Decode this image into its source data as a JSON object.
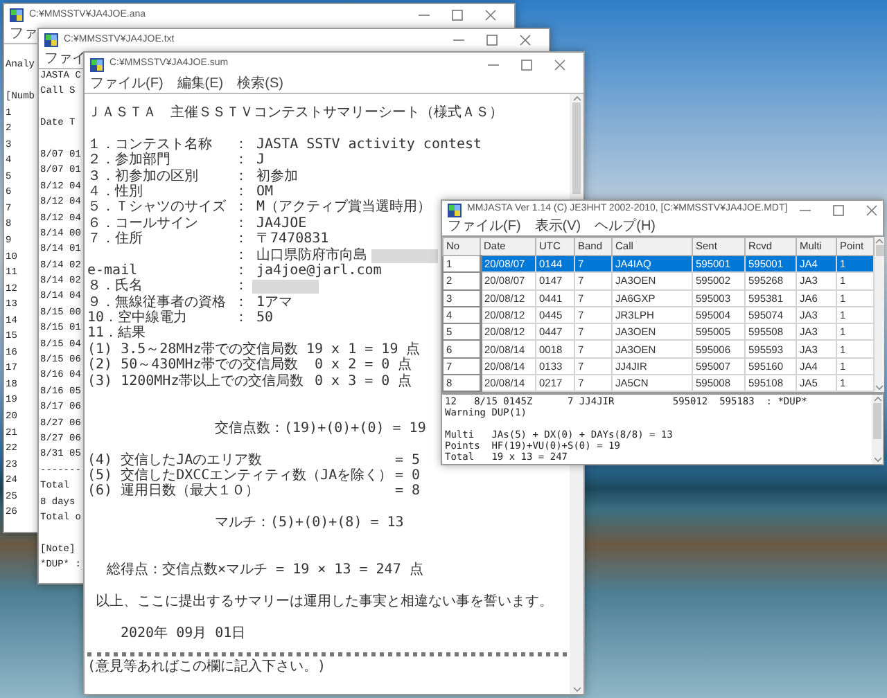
{
  "analysis_window": {
    "title": "C:¥MMSSTV¥JA4JOE.ana",
    "menu": [
      "ファ"
    ],
    "paragraphs": [
      [
        "Analy"
      ],
      [
        "[Numb",
        "1",
        "2",
        "3",
        "4",
        "5",
        "6",
        "7",
        "8",
        "9",
        "10",
        "11",
        "12",
        "13",
        "14",
        "15",
        "16",
        "17",
        "18",
        "19",
        "20",
        "21",
        "22",
        "23",
        "24",
        "25",
        "26"
      ]
    ]
  },
  "log_text_window": {
    "title": "C:¥MMSSTV¥JA4JOE.txt",
    "menu": [
      "ファイ"
    ],
    "paragraphs": [
      [
        "JASTA C",
        "Call S"
      ],
      [
        "Date T"
      ],
      [
        "8/07 01",
        "8/07 01",
        "8/12 04",
        "8/12 04",
        "8/12 04",
        "8/14 00",
        "8/14 01",
        "8/14 02",
        "8/14 02",
        "8/14 04",
        "8/15 00",
        "8/15 01",
        "8/15 04",
        "8/15 06",
        "8/16 04",
        "8/16 05",
        "8/17 06",
        "8/27 06",
        "8/27 06",
        "8/31 05",
        "-------",
        "Total",
        "8 days",
        "Total o"
      ],
      [
        "[Note]",
        "*DUP* :"
      ]
    ]
  },
  "summary_window": {
    "title": "C:¥MMSSTV¥JA4JOE.sum",
    "menu": [
      "ファイル(F)",
      "編集(E)",
      "検索(S)"
    ],
    "blocks": [
      {
        "kind": "title",
        "text": "ＪＡＳＴＡ　主催ＳＳＴＶコンテストサマリーシート（様式ＡＳ）"
      },
      {
        "kind": "fields",
        "rows": [
          {
            "label": "１．コンテスト名称",
            "value": "： JASTA SSTV activity contest",
            "redacted": false
          },
          {
            "label": "２．参加部門",
            "value": "： J",
            "redacted": false
          },
          {
            "label": "３．初参加の区別",
            "value": "： 初参加",
            "redacted": false
          },
          {
            "label": "４．性別",
            "value": "： OM",
            "redacted": false
          },
          {
            "label": "５．Ｔシャツのサイズ",
            "value": "： M（アクティブ賞当選時用）",
            "redacted": false
          },
          {
            "label": "６．コールサイン",
            "value": "： JA4JOE",
            "redacted": false
          },
          {
            "label": "７．住所",
            "value": "： 〒7470831",
            "redacted": false
          },
          {
            "value": "： 山口県防府市向島",
            "redacted": true
          },
          {
            "label": "e-mail",
            "value": "： ja4joe@jarl.com",
            "redacted": false
          },
          {
            "label": "８．氏名",
            "value": "：",
            "redacted": true
          },
          {
            "label": "９．無線従事者の資格",
            "value": "： 1アマ",
            "redacted": false
          },
          {
            "label": "10．空中線電力",
            "value": "： 50",
            "redacted": false
          },
          {
            "label": "11．結果",
            "redacted": false
          }
        ]
      },
      {
        "kind": "counts",
        "rows": [
          {
            "label": "(1) 3.5～28MHz帯での交信局数",
            "value": "19 x 1 = 19 点"
          },
          {
            "label": "(2) 50～430MHz帯での交信局数",
            "value": " 0 x 2 = 0 点"
          },
          {
            "label": "(3) 1200MHz帯以上での交信局数",
            "value": " 0 x 3 = 0 点"
          }
        ]
      },
      {
        "kind": "points",
        "text": "交信点数：(19)+(0)+(0) = 19"
      },
      {
        "kind": "areas",
        "rows": [
          {
            "label": "(4) 交信したJAのエリア数",
            "value": "= 5"
          },
          {
            "label": "(5) 交信したDXCCエンティティ数（JAを除く）",
            "value": "= 0"
          },
          {
            "label": "(6) 運用日数（最大１０）",
            "value": "= 8"
          }
        ]
      },
      {
        "kind": "multiplier",
        "text": "マルチ：(5)+(0)+(8) = 13"
      },
      {
        "kind": "total",
        "text": "総得点：交信点数×マルチ = 19 × 13 = 247 点"
      },
      {
        "kind": "statement",
        "text": "以上、ここに提出するサマリーは運用した事実と相違ない事を誓います。"
      },
      {
        "kind": "date",
        "text": "2020年 09月 01日"
      },
      {
        "kind": "separator"
      },
      {
        "kind": "note",
        "text": "(意見等あればこの欄に記入下さい。)"
      }
    ]
  },
  "mmjasta_window": {
    "title": "MMJASTA Ver 1.14 (C) JE3HHT 2002-2010, [C:¥MMSSTV¥JA4JOE.MDT]",
    "menu": [
      "ファイル(F)",
      "表示(V)",
      "ヘルプ(H)"
    ],
    "table": {
      "columns": [
        "No",
        "Date",
        "UTC",
        "Band",
        "Call",
        "Sent",
        "Rcvd",
        "Multi",
        "Point"
      ],
      "rows": [
        {
          "cells": [
            "1",
            "20/08/07",
            "0144",
            "7",
            "JA4IAQ",
            "595001",
            "595001",
            "JA4",
            "1"
          ],
          "selected": true
        },
        {
          "cells": [
            "2",
            "20/08/07",
            "0147",
            "7",
            "JA3OEN",
            "595002",
            "595268",
            "JA3",
            "1"
          ],
          "selected": false
        },
        {
          "cells": [
            "3",
            "20/08/12",
            "0441",
            "7",
            "JA6GXP",
            "595003",
            "595381",
            "JA6",
            "1"
          ],
          "selected": false
        },
        {
          "cells": [
            "4",
            "20/08/12",
            "0445",
            "7",
            "JR3LPH",
            "595004",
            "595074",
            "JA3",
            "1"
          ],
          "selected": false
        },
        {
          "cells": [
            "5",
            "20/08/12",
            "0447",
            "7",
            "JA3OEN",
            "595005",
            "595508",
            "JA3",
            "1"
          ],
          "selected": false
        },
        {
          "cells": [
            "6",
            "20/08/14",
            "0018",
            "7",
            "JA3OEN",
            "595006",
            "595593",
            "JA3",
            "1"
          ],
          "selected": false
        },
        {
          "cells": [
            "7",
            "20/08/14",
            "0133",
            "7",
            "JJ4JIR",
            "595007",
            "595160",
            "JA4",
            "1"
          ],
          "selected": false
        },
        {
          "cells": [
            "8",
            "20/08/14",
            "0217",
            "7",
            "JA5CN",
            "595008",
            "595108",
            "JA5",
            "1"
          ],
          "selected": false
        }
      ]
    },
    "log": [
      [
        "12   8/15 0145Z      7 JJ4JIR          595012  595183  : *DUP*",
        "Warning DUP(1)"
      ],
      [
        "Multi   JAs(5) + DX(0) + DAYs(8/8) = 13",
        "Points  HF(19)+VU(0)+S(0) = 19",
        "Total   19 x 13 = 247"
      ]
    ]
  }
}
